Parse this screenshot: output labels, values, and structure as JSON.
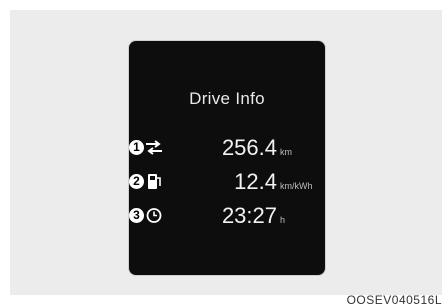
{
  "panel": {
    "title": "Drive Info"
  },
  "rows": [
    {
      "number": "1",
      "icon": "distance-arrows-icon",
      "value": "256.4",
      "unit": "km"
    },
    {
      "number": "2",
      "icon": "energy-station-icon",
      "value": "12.4",
      "unit": "km/kWh"
    },
    {
      "number": "3",
      "icon": "clock-icon",
      "value": "23:27",
      "unit": "h"
    }
  ],
  "figure_code": "OOSEV040516L"
}
